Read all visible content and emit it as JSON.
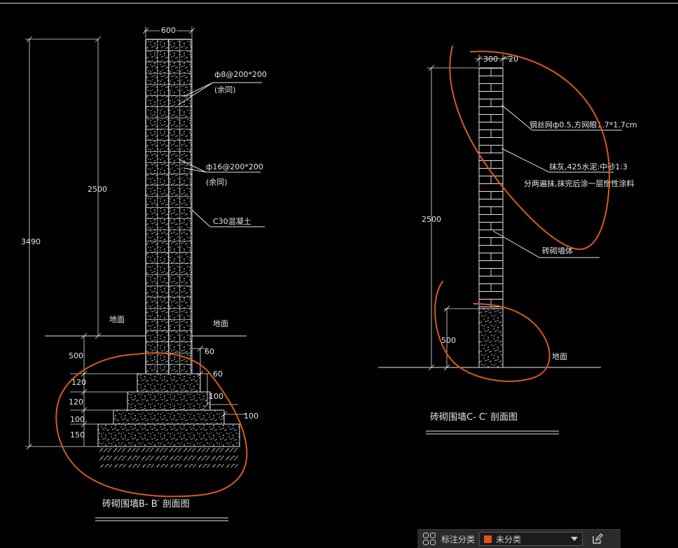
{
  "left_section": {
    "title": "砖砌围墙B- B′ 剖面图",
    "dim_top_width": "600",
    "dim_total_height": "3490",
    "dim_wall_height": "2500",
    "rebar_1_label": "ф8@200*200",
    "rebar_1_note": "(余同)",
    "rebar_2_label": "ф16@200*200",
    "rebar_2_note": "(余同)",
    "concrete_label": "C30混凝土",
    "ground_left": "地面",
    "ground_right": "地面",
    "footing_dims_left": [
      "500",
      "120",
      "120",
      "100",
      "150"
    ],
    "footing_dims_right": [
      "60",
      "60",
      "100",
      "100"
    ]
  },
  "right_section": {
    "title": "砖砌围墙C- C′ 剖面图",
    "dim_top_width": "300",
    "dim_top_offset": "20",
    "dim_wall_height": "2500",
    "dim_base_height": "500",
    "mesh_label": "钢丝网ф0.5,方网眼1.7*1.7cm",
    "plaster_label": "抹灰,425水泥:中砂1:3",
    "coating_label": "分两遍抹,抹完后涂一层憎性涂料",
    "brick_label": "砖砌墙体",
    "ground_label": "地面"
  },
  "toolbar": {
    "label": "标注分类",
    "selected": "未分类",
    "swatch_color": "#e0521d",
    "grid_icon": "grid-icon",
    "edit_icon": "edit-icon"
  },
  "colors": {
    "background": "#000000",
    "lines": "#e6e6e6",
    "markup": "#d75a1b"
  }
}
